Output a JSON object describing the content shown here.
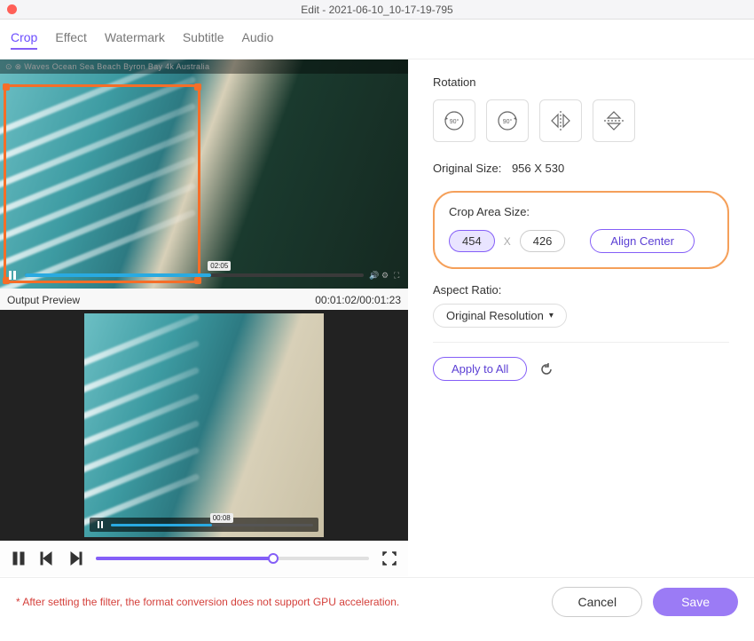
{
  "window": {
    "title": "Edit - 2021-06-10_10-17-19-795"
  },
  "tabs": [
    "Crop",
    "Effect",
    "Watermark",
    "Subtitle",
    "Audio"
  ],
  "active_tab": 0,
  "video_meta": "⊙ ⊗  Waves  Ocean  Sea  Beach  Byron Bay  4k  Australia",
  "top_player": {
    "badge": "02:05",
    "progress_pct": 55
  },
  "preview_label_left": "Output Preview",
  "preview_label_right": "00:01:02/00:01:23",
  "preview_player": {
    "badge": "00:08",
    "progress_pct": 50
  },
  "seek_pct": 65,
  "rotation": {
    "label": "Rotation"
  },
  "original_size": {
    "label": "Original Size:",
    "value": "956 X 530"
  },
  "crop_area": {
    "label": "Crop Area Size:",
    "width": "454",
    "height": "426",
    "align": "Align Center"
  },
  "aspect": {
    "label": "Aspect Ratio:",
    "value": "Original Resolution"
  },
  "apply_all": "Apply to All",
  "footer": {
    "warning": "* After setting the filter, the format conversion does not support GPU acceleration.",
    "cancel": "Cancel",
    "save": "Save"
  }
}
